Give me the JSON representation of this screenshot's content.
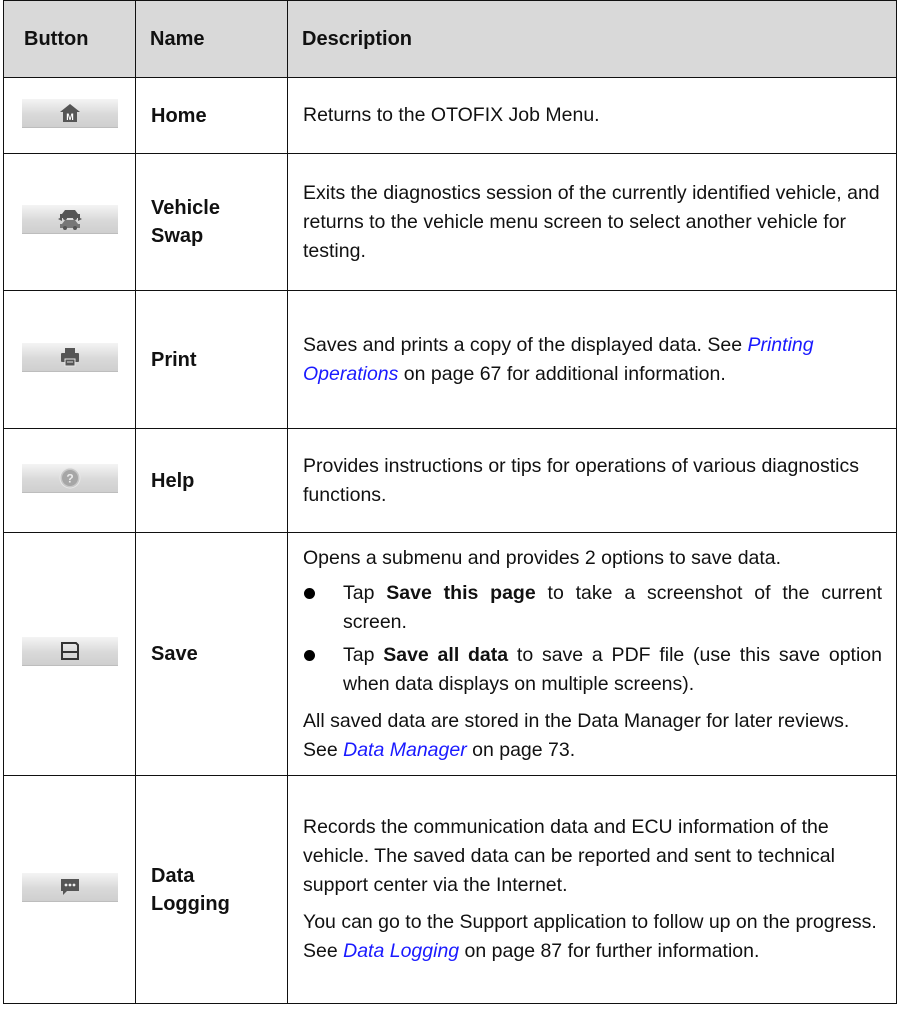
{
  "header": {
    "button": "Button",
    "name": "Name",
    "description": "Description"
  },
  "rows": [
    {
      "icon": "home-icon",
      "name": "Home",
      "desc": {
        "text": "Returns to the OTOFIX Job Menu."
      }
    },
    {
      "icon": "vehicle-swap-icon",
      "name_line1": "Vehicle",
      "name_line2": "Swap",
      "desc": {
        "text": "Exits the diagnostics session of the currently identified vehicle, and returns to the vehicle menu screen to select another vehicle for testing."
      }
    },
    {
      "icon": "printer-icon",
      "name": "Print",
      "desc": {
        "pre": "Saves and prints a copy of the displayed data. See ",
        "link": "Printing Operations",
        "post": " on page 67 for additional information."
      }
    },
    {
      "icon": "help-icon",
      "name": "Help",
      "desc": {
        "text": "Provides instructions or tips for operations of various diagnostics functions."
      }
    },
    {
      "icon": "save-icon",
      "name": "Save",
      "desc": {
        "intro": "Opens a submenu and provides 2 options to save data.",
        "bullets": [
          {
            "pre": "Tap ",
            "bold": "Save this page",
            "post": " to take a screenshot of the current screen."
          },
          {
            "pre": "Tap ",
            "bold": "Save all data",
            "post": " to save a PDF file (use this save option when data displays on multiple screens)."
          }
        ],
        "outro_pre": "All saved data are stored in the Data Manager for later reviews. See ",
        "outro_link": "Data Manager",
        "outro_post": " on page 73."
      }
    },
    {
      "icon": "data-logging-icon",
      "name_line1": "Data",
      "name_line2": "Logging",
      "desc": {
        "p1": "Records the communication data and ECU information of the vehicle. The saved data can be reported and sent to technical support center via the Internet.",
        "p2_pre": "You can go to the Support application to follow up on the progress. See ",
        "p2_link": "Data Logging",
        "p2_post": " on page 87 for further information."
      }
    }
  ]
}
